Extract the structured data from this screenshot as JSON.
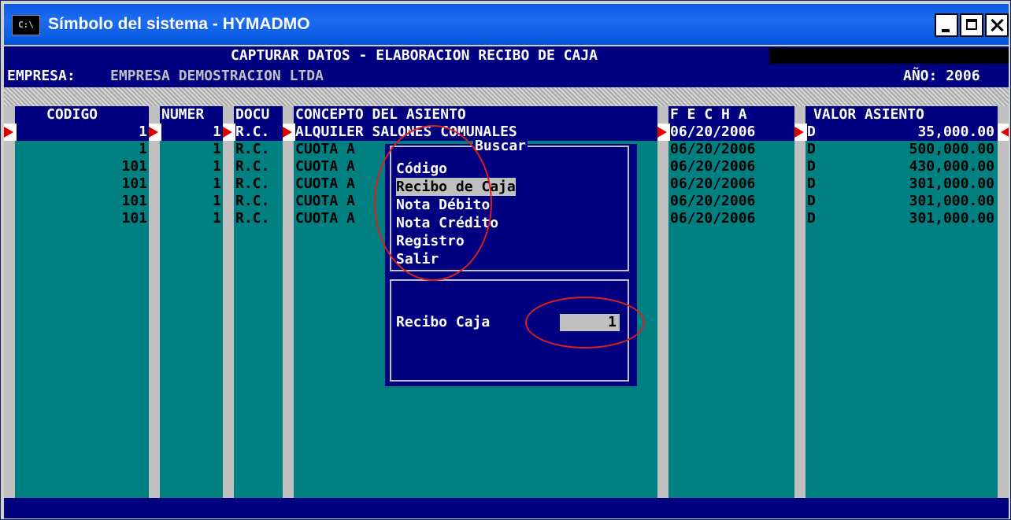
{
  "window": {
    "icon_label": "C:\\",
    "title": "Símbolo del sistema - HYMADMO",
    "controls": {
      "minimize": "minimize-icon",
      "maximize": "maximize-icon",
      "close": "close-icon"
    }
  },
  "header": {
    "caption": "CAPTURAR DATOS - ELABORACION RECIBO DE CAJA",
    "empresa_label": "EMPRESA:",
    "empresa_value": "EMPRESA DEMOSTRACION LTDA",
    "ano_label": "AÑO:",
    "ano_value": "2006"
  },
  "columns": {
    "codigo": "CODIGO",
    "numero": "NUMER",
    "documento": "DOCU",
    "concepto": "CONCEPTO DEL ASIENTO",
    "fecha": "F E C H A",
    "valor": "VALOR ASIENTO"
  },
  "rows": [
    {
      "codigo": "1",
      "numero": "1",
      "documento": "R.C.",
      "concepto": "ALQUILER SALONES COMUNALES",
      "fecha": "06/20/2006",
      "dc": "D",
      "valor": "35,000.00"
    },
    {
      "codigo": "1",
      "numero": "1",
      "documento": "R.C.",
      "concepto": "CUOTA A",
      "fecha": "06/20/2006",
      "dc": "D",
      "valor": "500,000.00"
    },
    {
      "codigo": "101",
      "numero": "1",
      "documento": "R.C.",
      "concepto": "CUOTA A",
      "fecha": "06/20/2006",
      "dc": "D",
      "valor": "430,000.00"
    },
    {
      "codigo": "101",
      "numero": "1",
      "documento": "R.C.",
      "concepto": "CUOTA A",
      "fecha": "06/20/2006",
      "dc": "D",
      "valor": "301,000.00"
    },
    {
      "codigo": "101",
      "numero": "1",
      "documento": "R.C.",
      "concepto": "CUOTA A",
      "fecha": "06/20/2006",
      "dc": "D",
      "valor": "301,000.00"
    },
    {
      "codigo": "101",
      "numero": "1",
      "documento": "R.C.",
      "concepto": "CUOTA A",
      "fecha": "06/20/2006",
      "dc": "D",
      "valor": "301,000.00"
    }
  ],
  "popup": {
    "title": "Buscar",
    "options": [
      "Código",
      "Recibo de Caja",
      "Nota Débito",
      "Nota Crédito",
      "Registro",
      "Salir"
    ],
    "selected_index": 1,
    "field_label": "Recibo Caja",
    "field_value": "1"
  },
  "colors": {
    "console_bg": "#008080",
    "header_bg": "#000080",
    "highlight": "#000080",
    "marker": "#e00000",
    "annotation": "#d82020"
  }
}
